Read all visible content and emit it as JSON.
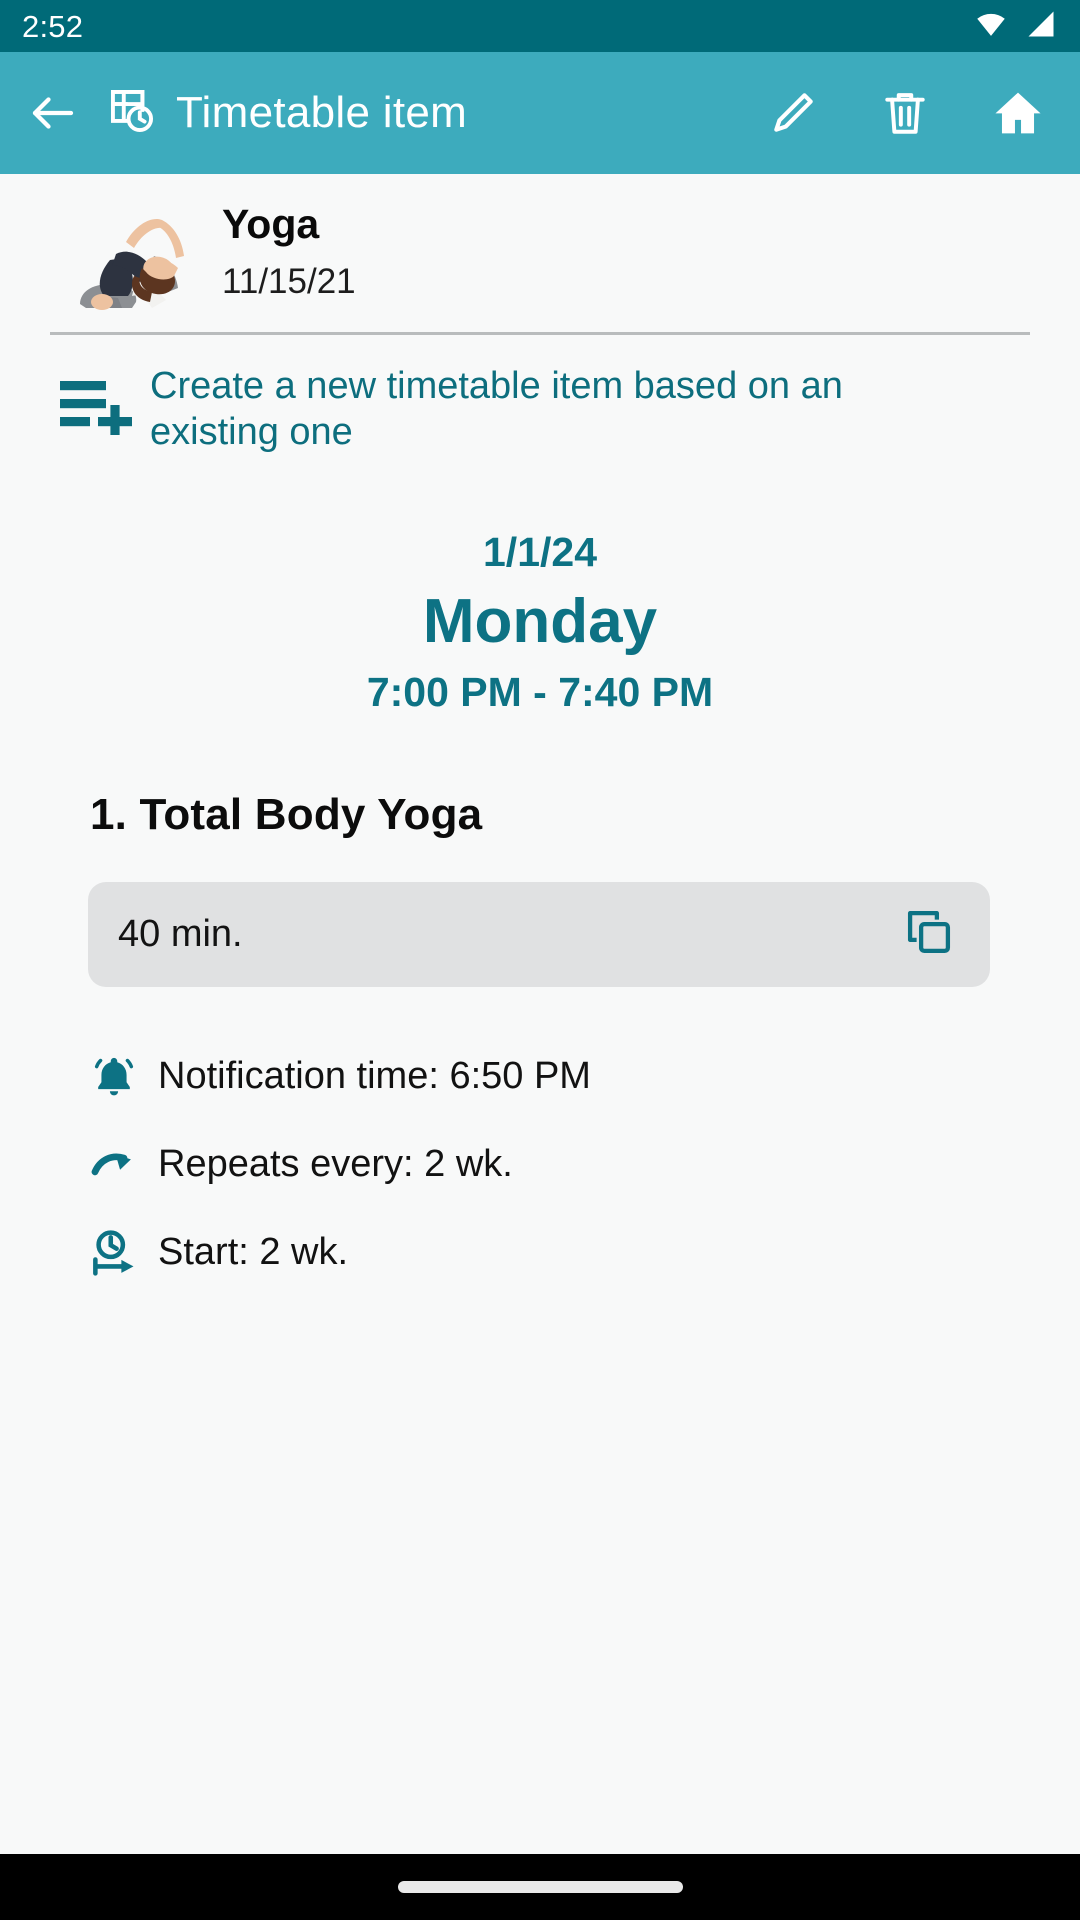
{
  "status_bar": {
    "time": "2:52",
    "icons": [
      "wifi-icon",
      "cellular-signal-icon"
    ]
  },
  "app_bar": {
    "back_icon": "arrow-back-icon",
    "leading_icon": "timetable-clock-icon",
    "title": "Timetable item",
    "actions": [
      {
        "name": "edit-button",
        "icon": "pencil-icon"
      },
      {
        "name": "delete-button",
        "icon": "trash-icon"
      },
      {
        "name": "home-button",
        "icon": "home-icon"
      }
    ]
  },
  "item": {
    "thumbnail": "yoga-pose-image",
    "name": "Yoga",
    "date": "11/15/21"
  },
  "create_new": {
    "icon": "playlist-add-icon",
    "label": "Create a new timetable item based on an existing one"
  },
  "schedule": {
    "date": "1/1/24",
    "day": "Monday",
    "time_range": "7:00 PM - 7:40 PM"
  },
  "session": {
    "title": "1. Total Body Yoga",
    "duration": "40 min.",
    "copy_icon": "copy-icon"
  },
  "details": [
    {
      "icon": "bell-icon",
      "text": "Notification time: 6:50 PM"
    },
    {
      "icon": "repeat-arrow-icon",
      "text": "Repeats every: 2 wk."
    },
    {
      "icon": "start-clock-icon",
      "text": "Start: 2 wk."
    }
  ],
  "colors": {
    "status_bar": "#006a78",
    "app_bar": "#3dabbd",
    "accent": "#0d7284",
    "link": "#0d6e7e",
    "card_bg": "#e0e1e2",
    "page_bg": "#f8f9f9",
    "nav_bg": "#000000"
  }
}
